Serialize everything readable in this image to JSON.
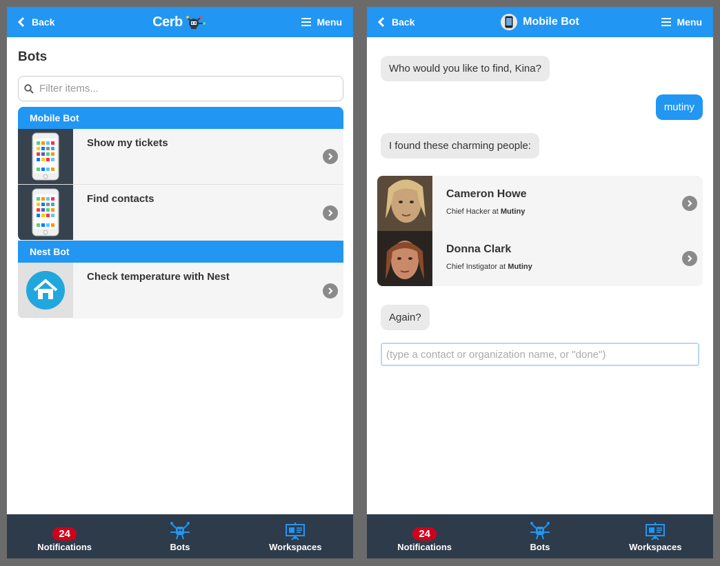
{
  "left": {
    "topbar": {
      "back_label": "Back",
      "brand": "Cerb",
      "menu_label": "Menu"
    },
    "page_title": "Bots",
    "filter": {
      "placeholder": "Filter items...",
      "value": ""
    },
    "groups": [
      {
        "header": "Mobile Bot",
        "items": [
          {
            "label": "Show my tickets",
            "thumb": "phone-icon"
          },
          {
            "label": "Find contacts",
            "thumb": "phone-icon"
          }
        ]
      },
      {
        "header": "Nest Bot",
        "items": [
          {
            "label": "Check temperature with Nest",
            "thumb": "nest-home-icon"
          }
        ]
      }
    ],
    "bottomnav": {
      "notifications_count": "24",
      "notifications_label": "Notifications",
      "bots_label": "Bots",
      "workspaces_label": "Workspaces"
    }
  },
  "right": {
    "topbar": {
      "back_label": "Back",
      "title": "Mobile Bot",
      "menu_label": "Menu"
    },
    "messages": [
      {
        "from": "bot",
        "text": "Who would you like to find, Kina?"
      },
      {
        "from": "user",
        "text": "mutiny"
      },
      {
        "from": "bot",
        "text": "I found these charming people:"
      },
      {
        "from": "bot",
        "text": "Again?"
      }
    ],
    "contacts": [
      {
        "name": "Cameron Howe",
        "title": "Chief Hacker",
        "at": "at",
        "org": "Mutiny"
      },
      {
        "name": "Donna Clark",
        "title": "Chief Instigator",
        "at": "at",
        "org": "Mutiny"
      }
    ],
    "input": {
      "placeholder": "(type a contact or organization name, or \"done\")",
      "value": ""
    },
    "bottomnav": {
      "notifications_count": "24",
      "notifications_label": "Notifications",
      "bots_label": "Bots",
      "workspaces_label": "Workspaces"
    }
  },
  "colors": {
    "accent": "#2196f3",
    "nav_bg": "#2e3b4b",
    "badge": "#d0021b",
    "frame": "#6b6b6b"
  }
}
